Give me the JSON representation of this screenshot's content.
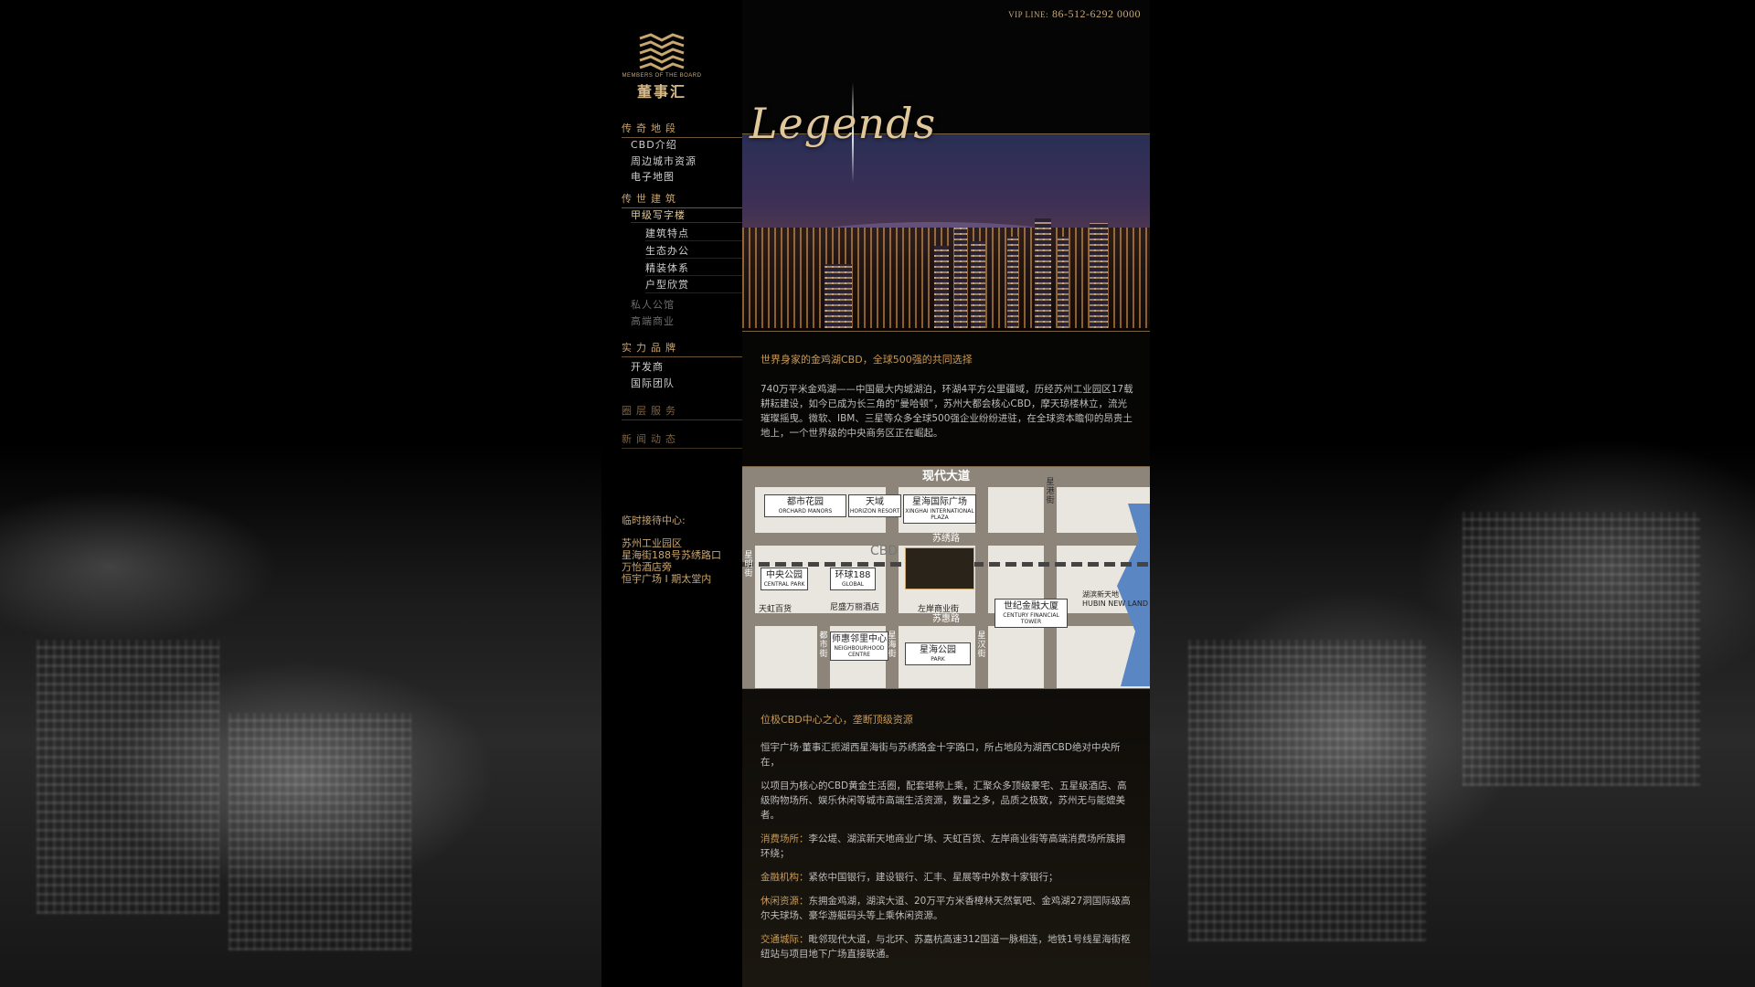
{
  "header": {
    "vip_prefix": "VIP LINE:",
    "vip_number": "86-512-6292 0000"
  },
  "logo": {
    "tagline": "MEMBERS OF THE BOARD",
    "name": "董事汇"
  },
  "nav": {
    "sec1": "传奇地段",
    "sec1_items": [
      "CBD介绍",
      "周边城市资源",
      "电子地图"
    ],
    "sec2": "传世建筑",
    "sec2_selected": "甲级写字楼",
    "sec2_sub": [
      "建筑特点",
      "生态办公",
      "精装体系",
      "户型欣赏"
    ],
    "sec2_more": [
      "私人公馆",
      "高端商业"
    ],
    "sec3": "实力品牌",
    "sec3_items": [
      "开发商",
      "国际团队"
    ],
    "sec4": "圈层服务",
    "sec5": "新闻动态"
  },
  "reception": {
    "title": "临时接待中心:",
    "lines": [
      "苏州工业园区",
      "星海街188号苏绣路口",
      "万怡酒店旁",
      "恒宇广场 I 期太堂内"
    ]
  },
  "hero": {
    "title": "Legends"
  },
  "section1": {
    "heading": "世界身家的金鸡湖CBD，全球500强的共同选择",
    "body": "740万平米金鸡湖——中国最大内城湖泊，环湖4平方公里疆域，历经苏州工业园区17载耕耘建设，如今已成为长三角的“曼哈顿”，苏州大都会核心CBD，摩天琼楼林立，流光璀璨摇曳。微软、IBM、三星等众多全球500强企业纷纷进驻，在全球资本瞻仰的昂贵土地上，一个世界级的中央商务区正在崛起。"
  },
  "map": {
    "top_road": "现代大道",
    "road_suxiu": "苏绣路",
    "road_suhui": "苏惠路",
    "cbd": "CBD",
    "label_xinggang": "星港街",
    "label_xingming": "星明街",
    "label_duyun": "都市街",
    "label_xinghai": "星海街",
    "label_xinghan": "星汉街",
    "orchard_cn": "都市花园",
    "orchard_en": "ORCHARD MANORS",
    "horizon_cn": "天域",
    "horizon_en": "HORIZON RESORT",
    "xinghai_plaza_cn": "星海国际广场",
    "xinghai_plaza_en": "XINGHAI INTERNATIONAL PLAZA",
    "central_park_cn": "中央公园",
    "central_park_en": "CENTRAL PARK",
    "global_cn": "环球188",
    "global_en": "GLOBAL",
    "tianhong": "天虹百货",
    "nisheng": "尼盛万丽酒店",
    "zuoan": "左岸商业街",
    "century_cn": "世纪金融大厦",
    "century_en": "CENTURY FINANCIAL TOWER",
    "hubin": "湖滨新天地",
    "hubin_en": "HUBIN NEW LAND",
    "neighbourhood_cn": "邻里中心",
    "neighbourhood_prefix": "师惠",
    "neighbourhood_en": "NEIGHBOURHOOD CENTRE",
    "park_cn": "星海公园",
    "park_en": "PARK"
  },
  "section2": {
    "heading": "位极CBD中心之心，垄断顶级资源",
    "p1": "恒宇广场·董事汇扼湖西星海街与苏绣路金十字路口，所占地段为湖西CBD绝对中央所在，",
    "p2": "以项目为核心的CBD黄金生活圈，配套堪称上乘，汇聚众多顶级豪宅、五星级酒店、高级购物场所、娱乐休闲等城市高端生活资源，数量之多，品质之极致，苏州无与能媲美者。",
    "p3_k": "消费场所：",
    "p3": "李公堤、湖滨新天地商业广场、天虹百货、左岸商业街等高端消费场所簇拥环绕；",
    "p4_k": "金融机构：",
    "p4": "紧依中国银行，建设银行、汇丰、星展等中外数十家银行；",
    "p5_k": "休闲资源：",
    "p5": "东拥金鸡湖，湖滨大道、20万平方米香樟林天然氧吧、金鸡湖27洞国际级高尔夫球场、豪华游艇码头等上乘休闲资源。",
    "p6_k": "交通城际：",
    "p6": "毗邻现代大道，与北环、苏嘉杭高速312国道一脉相连，地铁1号线星海街枢纽站与项目地下广场直接联通。"
  },
  "colors": {
    "accent": "#c9a66e",
    "heading": "#c99a55",
    "text": "#bdbdbd"
  }
}
